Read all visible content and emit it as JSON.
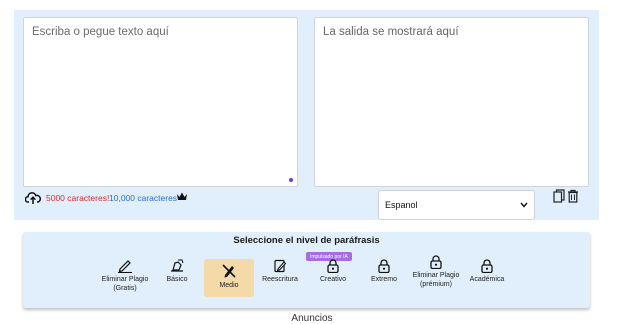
{
  "editor": {
    "input_placeholder": "Escriba o pegue texto aquí",
    "output_placeholder": "La salida se mostrará aquí",
    "free_limit": "5000 caracteres!",
    "premium_limit": "10,000 caracteres",
    "language": "Espanol"
  },
  "levels": {
    "title": "Seleccione el nivel de paráfrasis",
    "ai_badge": "Impulsado por IA",
    "modes": [
      {
        "line1": "Eliminar Plagio",
        "line2": "(Gratis)"
      },
      {
        "line1": "Básico",
        "line2": ""
      },
      {
        "line1": "Medio",
        "line2": ""
      },
      {
        "line1": "Reescritura",
        "line2": ""
      },
      {
        "line1": "Creativo",
        "line2": ""
      },
      {
        "line1": "Extremo",
        "line2": ""
      },
      {
        "line1": "Eliminar Plagio",
        "line2": "(prémium)"
      },
      {
        "line1": "Académica",
        "line2": ""
      }
    ],
    "active_mode": "Medio"
  },
  "footer": {
    "ads_label": "Anuncios"
  },
  "colors": {
    "panel_bg": "#e1effc",
    "active_mode_bg": "#f4d9a9",
    "badge_bg": "#a56be8",
    "free_limit": "#e0282e",
    "premium_limit": "#2a6fd6"
  },
  "icons": {
    "upload": "cloud-upload-icon",
    "crown": "crown-icon",
    "copy": "copy-icon",
    "delete": "trash-icon",
    "modes": [
      "pen-icon",
      "writing-hand-icon",
      "pencil-slash-icon",
      "edit-square-icon",
      "lock-icon",
      "lock-icon",
      "lock-icon",
      "lock-icon"
    ]
  }
}
